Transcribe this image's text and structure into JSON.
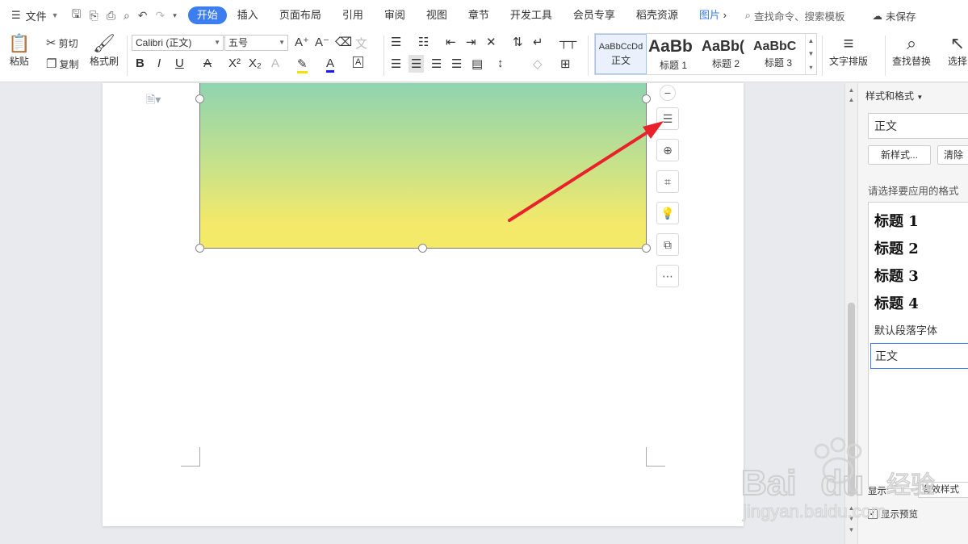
{
  "menubar": {
    "file_label": "文件",
    "tabs": [
      "开始",
      "插入",
      "页面布局",
      "引用",
      "审阅",
      "视图",
      "章节",
      "开发工具",
      "会员专享",
      "稻壳资源",
      "图片"
    ],
    "active_tab": "开始",
    "search_placeholder": "查找命令、搜索模板",
    "unsaved_label": "未保存"
  },
  "ribbon": {
    "paste": "粘贴",
    "cut": "剪切",
    "copy": "复制",
    "format_painter": "格式刷",
    "font_name": "Calibri (正文)",
    "font_size": "五号",
    "styles": [
      {
        "preview": "AaBbCcDd",
        "name": "正文"
      },
      {
        "preview": "AaBb",
        "name": "标题 1"
      },
      {
        "preview": "AaBb(",
        "name": "标题 2"
      },
      {
        "preview": "AaBbC",
        "name": "标题 3"
      }
    ],
    "text_layout": "文字排版",
    "find_replace": "查找替换",
    "select": "选择"
  },
  "float_tools": [
    "zoom-out-icon",
    "layout-options-icon",
    "zoom-in-icon",
    "crop-icon",
    "smart-icon",
    "convert-icon",
    "more-icon"
  ],
  "panel": {
    "header": "样式和格式",
    "current_style": "正文",
    "new_style_btn": "新样式...",
    "clear_btn": "清除",
    "hint": "请选择要应用的格式",
    "styles": [
      "标题 1",
      "标题 2",
      "标题 3",
      "标题 4",
      "默认段落字体",
      "正文"
    ],
    "selected_style": "正文",
    "show_label": "显示:",
    "show_value": "有效样式",
    "preview_label": "显示预览",
    "preview_checked": true
  },
  "watermark": {
    "brand": "Bai",
    "brand2": "du",
    "brand_cn": "经验",
    "url": "jingyan.baidu.com"
  },
  "colors": {
    "accent": "#3c7df0",
    "arrow": "#e8212b"
  }
}
